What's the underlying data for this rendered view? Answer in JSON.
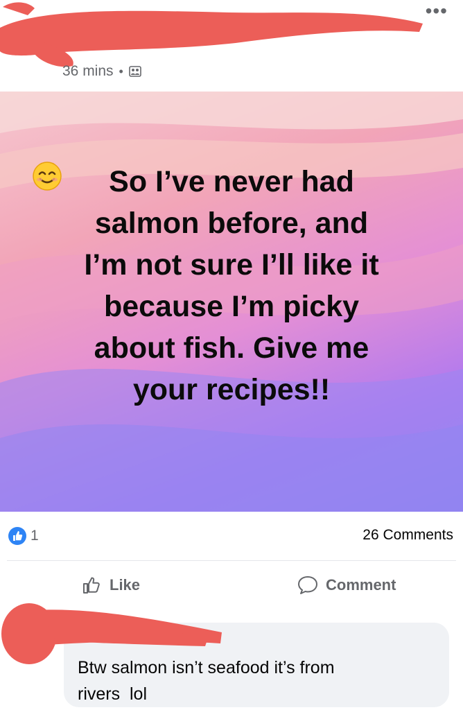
{
  "post": {
    "time": "36 mins",
    "separator": "•",
    "audience_icon": "friends-icon",
    "more_icon": "more-horizontal-icon",
    "more_label": "•••",
    "text_lines": [
      "So I’ve never had",
      "salmon before, and",
      "I’m not sure I’ll like it",
      "because I’m picky",
      "about fish. Give me",
      "your recipes!!"
    ],
    "emoji": "smiling-face-icon"
  },
  "stats": {
    "like_count": "1",
    "comments": "26 Comments"
  },
  "actions": {
    "like_label": "Like",
    "comment_label": "Comment"
  },
  "comment": {
    "text_line1": "Btw salmon isn’t seafood it’s from",
    "text_line2": "rivers  lol"
  },
  "colors": {
    "redaction": "#ec5e58",
    "like_blue": "#2e84f5",
    "secondary_text": "#65676b"
  }
}
